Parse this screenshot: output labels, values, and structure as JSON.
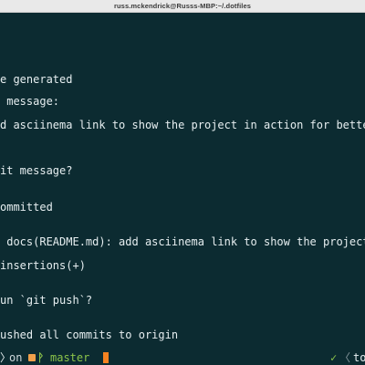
{
  "window": {
    "title": "russ.mckendrick@Russs-MBP:~/.dotfiles"
  },
  "terminal": {
    "lines": [
      "e generated",
      " message:",
      "d asciinema link to show the project in action for better user",
      "it message?",
      "ommitted",
      " docs(README.md): add asciinema link to show the project in act",
      "insertions(+)",
      "un `git push`?",
      "ushed all commits to origin"
    ]
  },
  "statusbar": {
    "prompt_arrow": "〉",
    "on_word": "on",
    "branch_icon": "ᚹ",
    "branch_name": "master",
    "ok_icon": "✓",
    "separator": "〈",
    "right_text": "to"
  },
  "colors": {
    "background": "#0c2b31",
    "text": "#e6eef0",
    "branch": "#8bc34a",
    "cursor": "#f58220",
    "titlebar": "#e9e9e9"
  }
}
